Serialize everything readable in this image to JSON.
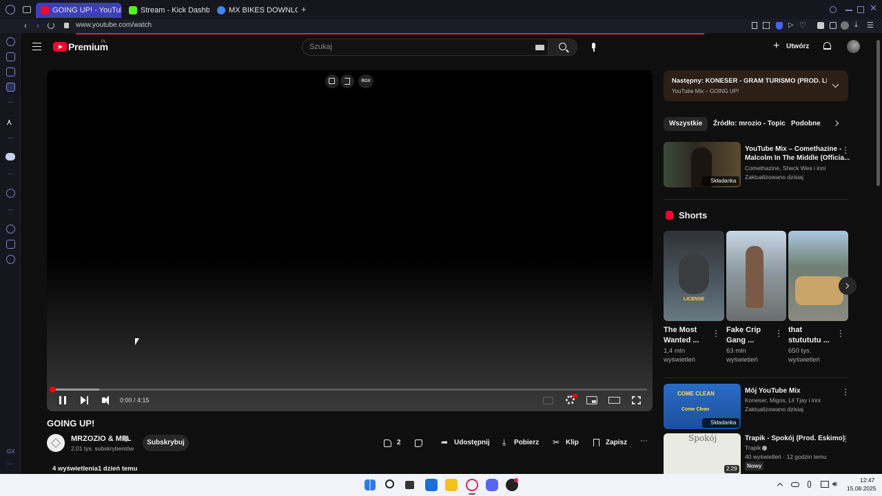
{
  "browser": {
    "tabs": [
      {
        "label": "GOING UP! - YouTube",
        "active": true,
        "favicon_color": "#ff0033"
      },
      {
        "label": "Stream - Kick Dashboard",
        "active": false,
        "favicon_color": "#53fc18"
      },
      {
        "label": "MX BIKES DOWNLOAD'",
        "active": false,
        "favicon_color": "#4285f4"
      }
    ],
    "url": "www.youtube.com/watch",
    "sidebar_bottom_label": "GX"
  },
  "header": {
    "logo_text": "Premium",
    "logo_region": "PL",
    "search_placeholder": "Szukaj",
    "create_label": "Utwórz"
  },
  "player": {
    "time": "0:00 / 4:15",
    "overlay_badge": "RGX",
    "progress": 0.0
  },
  "video": {
    "title": "GOING UP!",
    "channel": "MRZOZIO & MFL",
    "subscribers": "2,01 tys. subskrybentów",
    "subscribe_label": "Subskrybuj",
    "likes": "2",
    "share_label": "Udostępnij",
    "download_label": "Pobierz",
    "clip_label": "Klip",
    "save_label": "Zapisz",
    "views": "4 wyświetlenia",
    "age": "1 dzień temu"
  },
  "sidebar": {
    "next_title": "Następny: KONESER - GRAM TURISMO (PROD. LEA...",
    "next_sub": "YouTube Mix – GOING UP!",
    "chips": [
      "Wszystkie",
      "Źródło: mrozio - Topic",
      "Podobne"
    ],
    "mix1": {
      "title_line1": "YouTube Mix – Comethazine -",
      "title_line2": "Malcolm In The Middle (Officia...",
      "meta1": "Comethazine, Sheck Wes i inni",
      "meta2": "Zaktualizowano dzisiaj",
      "badge": "Składanka"
    },
    "shorts_heading": "Shorts",
    "shorts": [
      {
        "title_line1": "The Most",
        "title_line2": "Wanted ...",
        "meta1": "1,4 mln",
        "meta2": "wyświetleń",
        "thumb_text": "LICENSE"
      },
      {
        "title_line1": "Fake Crip",
        "title_line2": "Gang ...",
        "meta1": "63 mln",
        "meta2": "wyświetleń",
        "thumb_text": ""
      },
      {
        "title_line1": "that",
        "title_line2": "stutututu ...",
        "meta1": "650 tys.",
        "meta2": "wyświetleń",
        "thumb_text": ""
      }
    ],
    "mix2": {
      "title": "Mój YouTube Mix",
      "meta1": "Koneser, Migos, Lil Tjay i inni",
      "meta2": "Zaktualizowano dzisiaj",
      "badge": "Składanka",
      "thumb_text1": "COME CLEAN",
      "thumb_text2": "Come Clean"
    },
    "video3": {
      "title": "Trapik - Spokój (Prod. Eskimo)",
      "channel": "Trapik",
      "meta": "40 wyświetleń · 12 godzin temu",
      "badge": "Nowy",
      "duration": "2:29",
      "thumb_text": "Spokój"
    }
  },
  "taskbar": {
    "time": "12:47",
    "date": "15.08.2025"
  }
}
